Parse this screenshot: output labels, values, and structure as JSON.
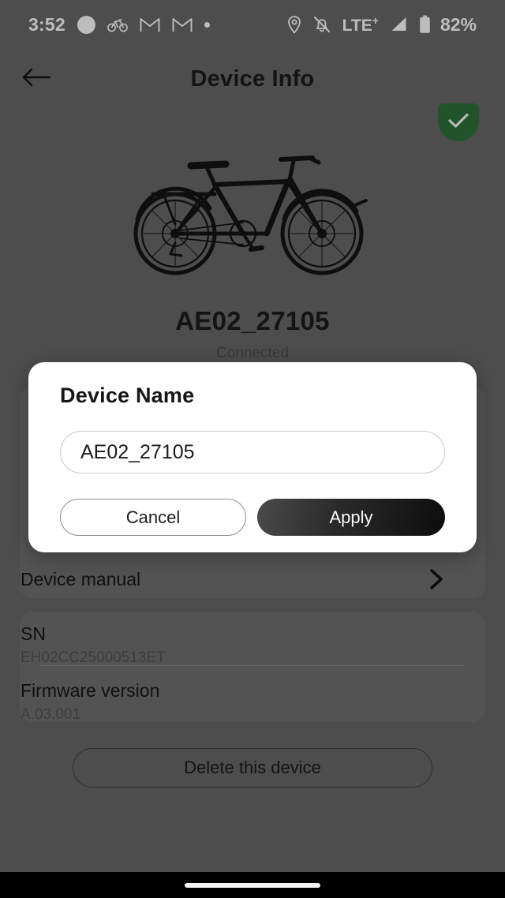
{
  "status_bar": {
    "time": "3:52",
    "left_icons": [
      "circle-dot-icon",
      "bicycle-icon",
      "gmail-icon",
      "gmail-icon",
      "small-dot-icon"
    ],
    "right_icons": [
      "location-pin-icon",
      "notifications-muted-icon"
    ],
    "network": "LTE",
    "network_sup": "+",
    "signal_icon": "signal-bars-icon",
    "battery_icon": "battery-icon",
    "battery": "82%"
  },
  "header": {
    "title": "Device Info",
    "back_icon": "back-arrow-icon"
  },
  "device": {
    "verified_icon": "verified-shield-check-icon",
    "image_icon": "ebike-illustration",
    "name": "AE02_27105",
    "status": "Connected"
  },
  "settings_card": {
    "device_manual": {
      "label": "Device manual",
      "chevron_icon": "chevron-right-icon"
    }
  },
  "info_card": {
    "items": [
      {
        "label": "SN",
        "value": "EH02CC25000513ET"
      },
      {
        "label": "Firmware version",
        "value": "A.03.001"
      }
    ]
  },
  "actions": {
    "delete_device": "Delete this device"
  },
  "dialog": {
    "title": "Device Name",
    "input_value": "AE02_27105",
    "input_placeholder": "Device Name",
    "cancel_label": "Cancel",
    "apply_label": "Apply"
  },
  "nav_bar": {
    "home_indicator": "home-indicator-pill"
  },
  "colors": {
    "accent_verified": "#2e6b38",
    "apply_button": "#0d0d0d",
    "page_background": "#636363"
  }
}
